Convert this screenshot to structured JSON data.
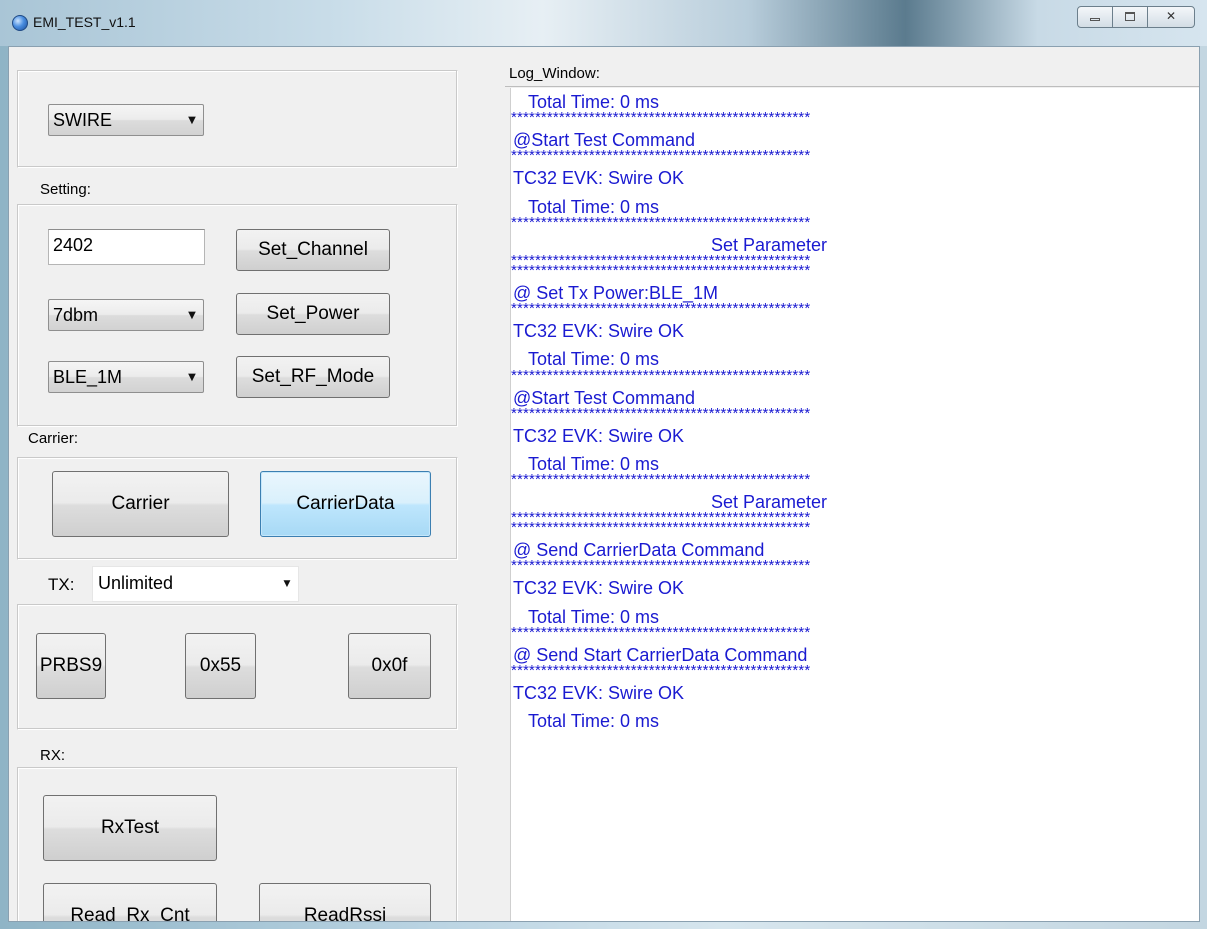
{
  "window": {
    "title": "EMI_TEST_v1.1",
    "controls": {
      "minimize": "–",
      "maximize": "□",
      "close": "✕"
    }
  },
  "interface": {
    "selected": "SWIRE"
  },
  "setting": {
    "label": "Setting:",
    "channel_value": "2402",
    "set_channel": "Set_Channel",
    "power_selected": "7dbm",
    "set_power": "Set_Power",
    "rf_mode_selected": "BLE_1M",
    "set_rf_mode": "Set_RF_Mode"
  },
  "carrier": {
    "label": "Carrier:",
    "carrier_button": "Carrier",
    "carrier_data_button": "CarrierData"
  },
  "tx": {
    "label": "TX:",
    "mode_selected": "Unlimited",
    "prbs9": "PRBS9",
    "x55": "0x55",
    "x0f": "0x0f"
  },
  "rx": {
    "label": "RX:",
    "rx_test": "RxTest",
    "read_rx_cnt": "Read_Rx_Cnt",
    "read_rssi": "ReadRssi"
  },
  "log": {
    "title": "Log_Window:",
    "lines": [
      "Total Time: 0 ms",
      "**************************************************",
      "@Start Test Command",
      "**************************************************",
      "TC32 EVK: Swire OK",
      "Total Time: 0 ms",
      "**************************************************",
      "Set Parameter",
      "**************************************************",
      "**************************************************",
      "@ Set Tx Power:BLE_1M",
      "**************************************************",
      "TC32 EVK: Swire OK",
      "Total Time: 0 ms",
      "**************************************************",
      "@Start Test Command",
      "**************************************************",
      "TC32 EVK: Swire OK",
      "Total Time: 0 ms",
      "**************************************************",
      "Set Parameter",
      "**************************************************",
      "**************************************************",
      "@ Send CarrierData Command",
      "**************************************************",
      "TC32 EVK: Swire OK",
      "Total Time: 0 ms",
      "**************************************************",
      "@ Send Start CarrierData Command",
      "**************************************************",
      "TC32 EVK: Swire OK",
      "Total Time: 0 ms"
    ]
  },
  "colors": {
    "log_text": "#1a1ad1",
    "focus_button": "#3c7fb1"
  }
}
